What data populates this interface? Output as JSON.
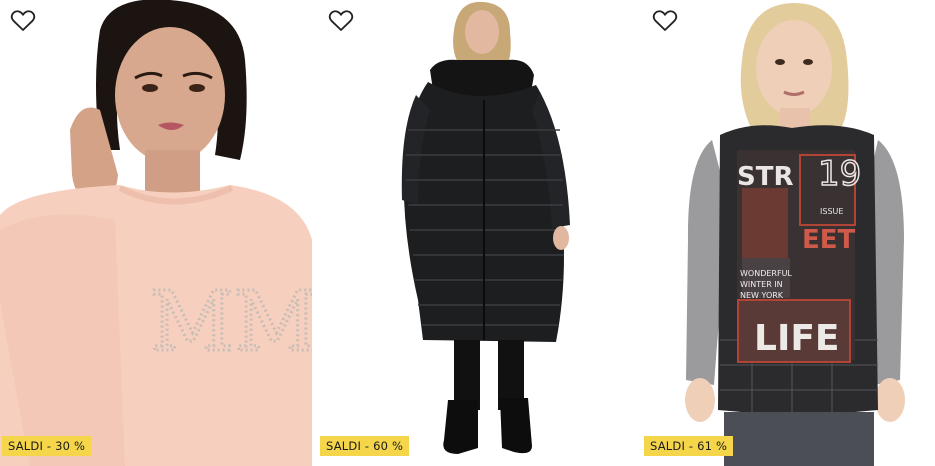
{
  "products": [
    {
      "badge": "SALDI - 30 %",
      "photo_icon": "knit-sweater-model-image"
    },
    {
      "badge": "SALDI - 60 %",
      "photo_icon": "puffer-coat-model-image"
    },
    {
      "badge": "SALDI - 61 %",
      "photo_icon": "printed-top-model-image"
    }
  ],
  "print_text": {
    "line1": "STR",
    "num": "19",
    "issue": "ISSUE",
    "line2": "EET",
    "small1": "WONDERFUL",
    "small2": "WINTER IN",
    "small3": "NEW YORK",
    "line3": "LIFE",
    "sweater_logo": "MM"
  },
  "colors": {
    "badge_bg": "#f5d54a",
    "heart_stroke": "#222222"
  }
}
